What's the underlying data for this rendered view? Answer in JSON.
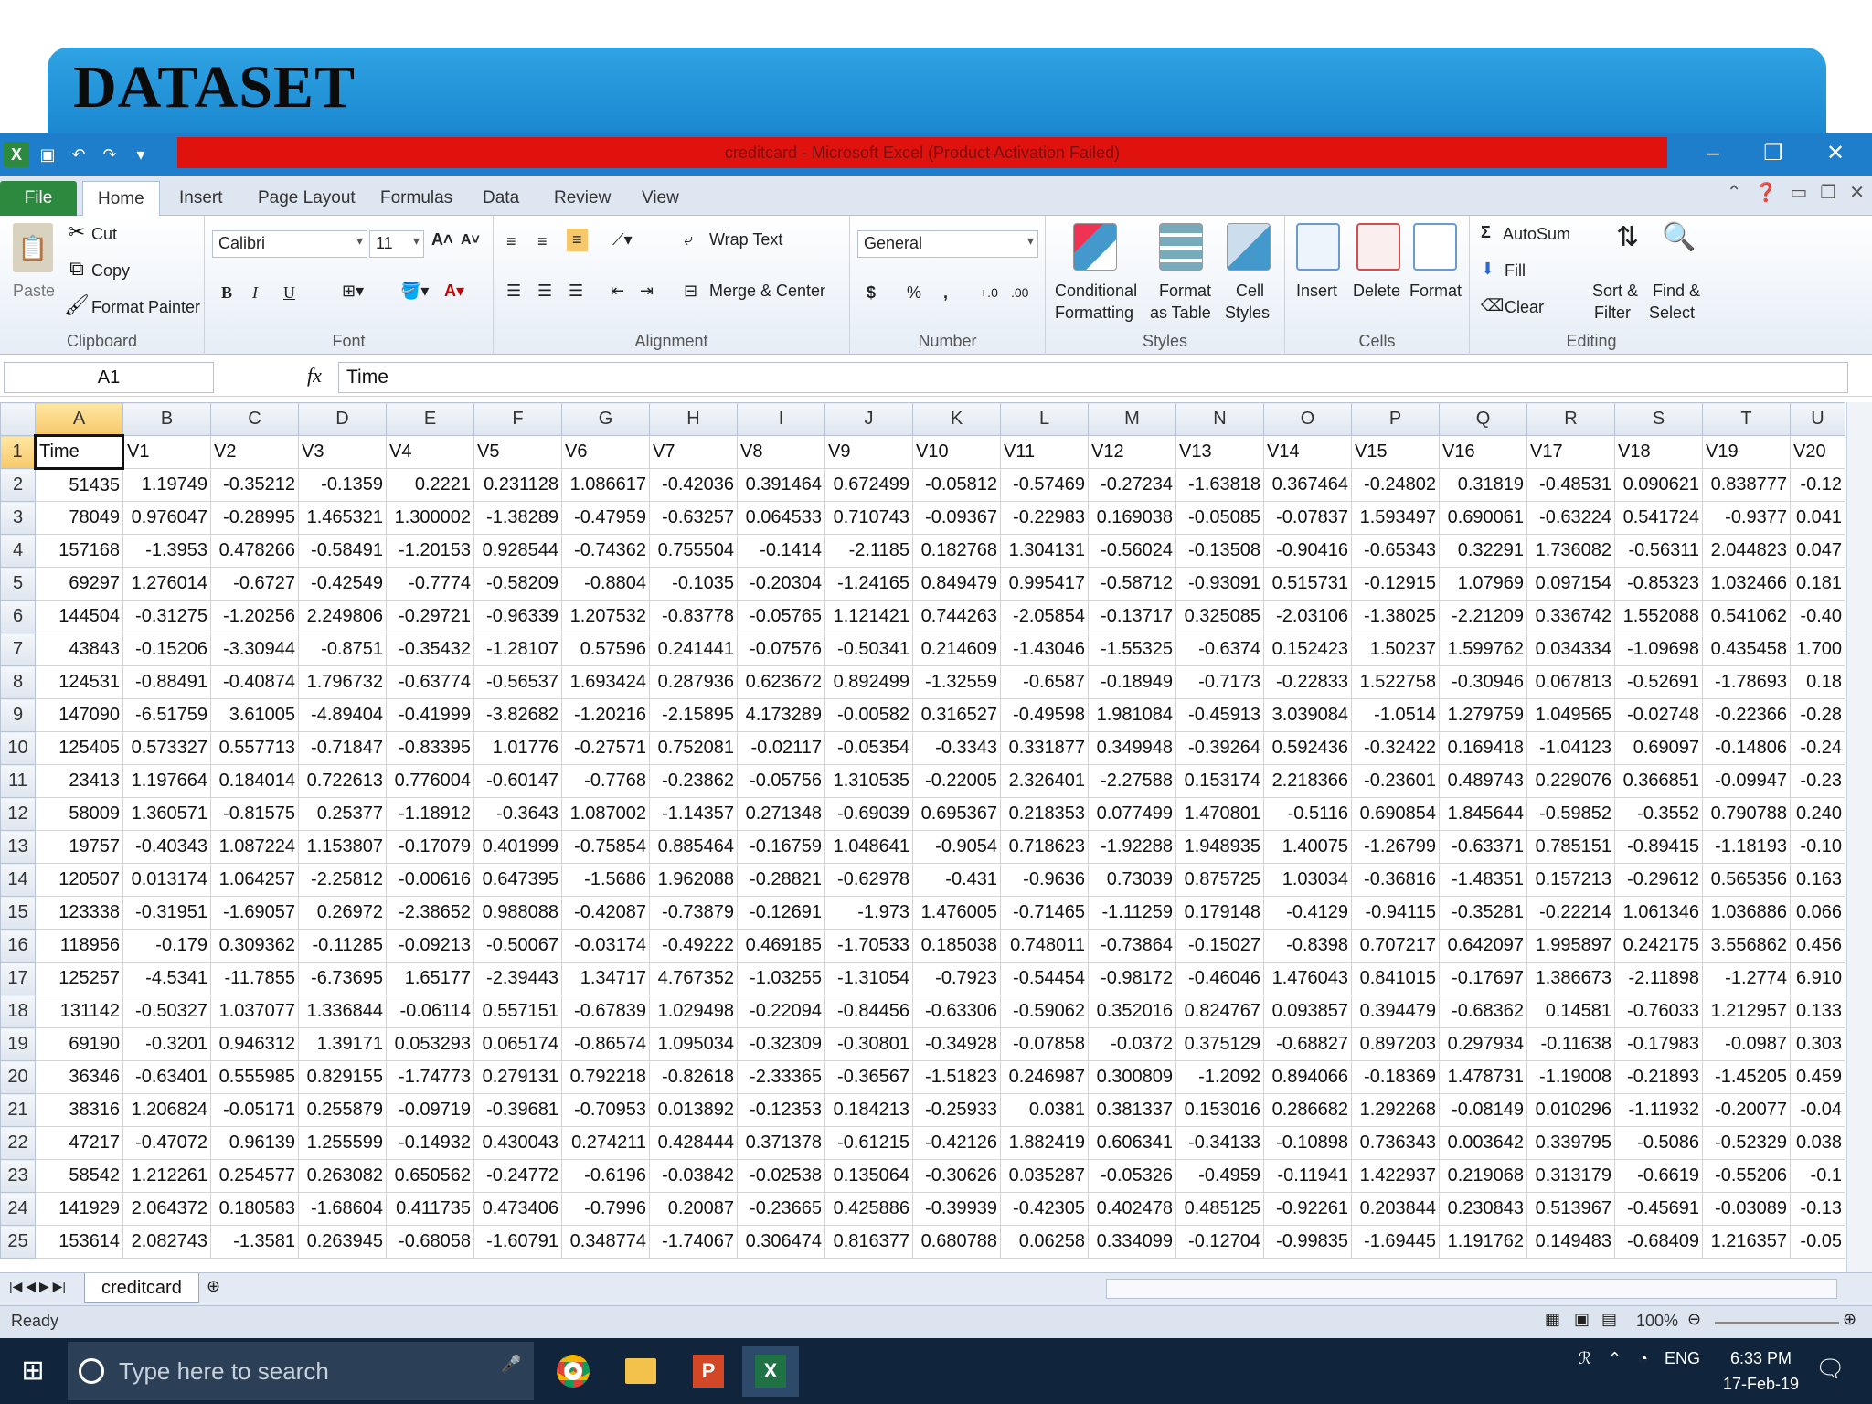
{
  "slide": {
    "title": "DATASET"
  },
  "window": {
    "title": "creditcard - Microsoft Excel (Product Activation Failed)"
  },
  "ribbon": {
    "tabs": [
      "File",
      "Home",
      "Insert",
      "Page Layout",
      "Formulas",
      "Data",
      "Review",
      "View"
    ],
    "active_tab": "Home",
    "clipboard": {
      "paste": "Paste",
      "cut": "Cut",
      "copy": "Copy",
      "format_painter": "Format Painter",
      "label": "Clipboard"
    },
    "font": {
      "name": "Calibri",
      "size": "11",
      "bold": "B",
      "italic": "I",
      "underline": "U",
      "label": "Font"
    },
    "alignment": {
      "wrap": "Wrap Text",
      "merge": "Merge & Center",
      "label": "Alignment"
    },
    "number": {
      "format": "General",
      "currency": "$",
      "percent": "%",
      "comma": ",",
      "label": "Number"
    },
    "styles": {
      "conditional": "Conditional",
      "conditional2": "Formatting",
      "format_table": "Format",
      "format_table2": "as Table",
      "cell_styles": "Cell",
      "cell_styles2": "Styles",
      "label": "Styles"
    },
    "cells": {
      "insert": "Insert",
      "delete": "Delete",
      "format": "Format",
      "label": "Cells"
    },
    "editing": {
      "autosum": "AutoSum",
      "fill": "Fill",
      "clear": "Clear",
      "sort": "Sort &",
      "sort2": "Filter",
      "find": "Find &",
      "find2": "Select",
      "label": "Editing"
    }
  },
  "formula_bar": {
    "cell_ref": "A1",
    "fx": "fx",
    "value": "Time"
  },
  "sheet": {
    "columns": [
      "A",
      "B",
      "C",
      "D",
      "E",
      "F",
      "G",
      "H",
      "I",
      "J",
      "K",
      "L",
      "M",
      "N",
      "O",
      "P",
      "Q",
      "R",
      "S",
      "T",
      "U"
    ],
    "rows": [
      [
        "Time",
        "V1",
        "V2",
        "V3",
        "V4",
        "V5",
        "V6",
        "V7",
        "V8",
        "V9",
        "V10",
        "V11",
        "V12",
        "V13",
        "V14",
        "V15",
        "V16",
        "V17",
        "V18",
        "V19",
        "V20"
      ],
      [
        "51435",
        "1.19749",
        "-0.35212",
        "-0.1359",
        "0.2221",
        "0.231128",
        "1.086617",
        "-0.42036",
        "0.391464",
        "0.672499",
        "-0.05812",
        "-0.57469",
        "-0.27234",
        "-1.63818",
        "0.367464",
        "-0.24802",
        "0.31819",
        "-0.48531",
        "0.090621",
        "0.838777",
        "-0.12"
      ],
      [
        "78049",
        "0.976047",
        "-0.28995",
        "1.465321",
        "1.300002",
        "-1.38289",
        "-0.47959",
        "-0.63257",
        "0.064533",
        "0.710743",
        "-0.09367",
        "-0.22983",
        "0.169038",
        "-0.05085",
        "-0.07837",
        "1.593497",
        "0.690061",
        "-0.63224",
        "0.541724",
        "-0.9377",
        "0.041"
      ],
      [
        "157168",
        "-1.3953",
        "0.478266",
        "-0.58491",
        "-1.20153",
        "0.928544",
        "-0.74362",
        "0.755504",
        "-0.1414",
        "-2.1185",
        "0.182768",
        "1.304131",
        "-0.56024",
        "-0.13508",
        "-0.90416",
        "-0.65343",
        "0.32291",
        "1.736082",
        "-0.56311",
        "2.044823",
        "0.047"
      ],
      [
        "69297",
        "1.276014",
        "-0.6727",
        "-0.42549",
        "-0.7774",
        "-0.58209",
        "-0.8804",
        "-0.1035",
        "-0.20304",
        "-1.24165",
        "0.849479",
        "0.995417",
        "-0.58712",
        "-0.93091",
        "0.515731",
        "-0.12915",
        "1.07969",
        "0.097154",
        "-0.85323",
        "1.032466",
        "0.181"
      ],
      [
        "144504",
        "-0.31275",
        "-1.20256",
        "2.249806",
        "-0.29721",
        "-0.96339",
        "1.207532",
        "-0.83778",
        "-0.05765",
        "1.121421",
        "0.744263",
        "-2.05854",
        "-0.13717",
        "0.325085",
        "-2.03106",
        "-1.38025",
        "-2.21209",
        "0.336742",
        "1.552088",
        "0.541062",
        "-0.40"
      ],
      [
        "43843",
        "-0.15206",
        "-3.30944",
        "-0.8751",
        "-0.35432",
        "-1.28107",
        "0.57596",
        "0.241441",
        "-0.07576",
        "-0.50341",
        "0.214609",
        "-1.43046",
        "-1.55325",
        "-0.6374",
        "0.152423",
        "1.50237",
        "1.599762",
        "0.034334",
        "-1.09698",
        "0.435458",
        "1.700"
      ],
      [
        "124531",
        "-0.88491",
        "-0.40874",
        "1.796732",
        "-0.63774",
        "-0.56537",
        "1.693424",
        "0.287936",
        "0.623672",
        "0.892499",
        "-1.32559",
        "-0.6587",
        "-0.18949",
        "-0.7173",
        "-0.22833",
        "1.522758",
        "-0.30946",
        "0.067813",
        "-0.52691",
        "-1.78693",
        "0.18"
      ],
      [
        "147090",
        "-6.51759",
        "3.61005",
        "-4.89404",
        "-0.41999",
        "-3.82682",
        "-1.20216",
        "-2.15895",
        "4.173289",
        "-0.00582",
        "0.316527",
        "-0.49598",
        "1.981084",
        "-0.45913",
        "3.039084",
        "-1.0514",
        "1.279759",
        "1.049565",
        "-0.02748",
        "-0.22366",
        "-0.28"
      ],
      [
        "125405",
        "0.573327",
        "0.557713",
        "-0.71847",
        "-0.83395",
        "1.01776",
        "-0.27571",
        "0.752081",
        "-0.02117",
        "-0.05354",
        "-0.3343",
        "0.331877",
        "0.349948",
        "-0.39264",
        "0.592436",
        "-0.32422",
        "0.169418",
        "-1.04123",
        "0.69097",
        "-0.14806",
        "-0.24"
      ],
      [
        "23413",
        "1.197664",
        "0.184014",
        "0.722613",
        "0.776004",
        "-0.60147",
        "-0.7768",
        "-0.23862",
        "-0.05756",
        "1.310535",
        "-0.22005",
        "2.326401",
        "-2.27588",
        "0.153174",
        "2.218366",
        "-0.23601",
        "0.489743",
        "0.229076",
        "0.366851",
        "-0.09947",
        "-0.23"
      ],
      [
        "58009",
        "1.360571",
        "-0.81575",
        "0.25377",
        "-1.18912",
        "-0.3643",
        "1.087002",
        "-1.14357",
        "0.271348",
        "-0.69039",
        "0.695367",
        "0.218353",
        "0.077499",
        "1.470801",
        "-0.5116",
        "0.690854",
        "1.845644",
        "-0.59852",
        "-0.3552",
        "0.790788",
        "0.240"
      ],
      [
        "19757",
        "-0.40343",
        "1.087224",
        "1.153807",
        "-0.17079",
        "0.401999",
        "-0.75854",
        "0.885464",
        "-0.16759",
        "1.048641",
        "-0.9054",
        "0.718623",
        "-1.92288",
        "1.948935",
        "1.40075",
        "-1.26799",
        "-0.63371",
        "0.785151",
        "-0.89415",
        "-1.18193",
        "-0.10"
      ],
      [
        "120507",
        "0.013174",
        "1.064257",
        "-2.25812",
        "-0.00616",
        "0.647395",
        "-1.5686",
        "1.962088",
        "-0.28821",
        "-0.62978",
        "-0.431",
        "-0.9636",
        "0.73039",
        "0.875725",
        "1.03034",
        "-0.36816",
        "-1.48351",
        "0.157213",
        "-0.29612",
        "0.565356",
        "0.163"
      ],
      [
        "123338",
        "-0.31951",
        "-1.69057",
        "0.26972",
        "-2.38652",
        "0.988088",
        "-0.42087",
        "-0.73879",
        "-0.12691",
        "-1.973",
        "1.476005",
        "-0.71465",
        "-1.11259",
        "0.179148",
        "-0.4129",
        "-0.94115",
        "-0.35281",
        "-0.22214",
        "1.061346",
        "1.036886",
        "0.066"
      ],
      [
        "118956",
        "-0.179",
        "0.309362",
        "-0.11285",
        "-0.09213",
        "-0.50067",
        "-0.03174",
        "-0.49222",
        "0.469185",
        "-1.70533",
        "0.185038",
        "0.748011",
        "-0.73864",
        "-0.15027",
        "-0.8398",
        "0.707217",
        "0.642097",
        "1.995897",
        "0.242175",
        "3.556862",
        "0.456"
      ],
      [
        "125257",
        "-4.5341",
        "-11.7855",
        "-6.73695",
        "1.65177",
        "-2.39443",
        "1.34717",
        "4.767352",
        "-1.03255",
        "-1.31054",
        "-0.7923",
        "-0.54454",
        "-0.98172",
        "-0.46046",
        "1.476043",
        "0.841015",
        "-0.17697",
        "1.386673",
        "-2.11898",
        "-1.2774",
        "6.910"
      ],
      [
        "131142",
        "-0.50327",
        "1.037077",
        "1.336844",
        "-0.06114",
        "0.557151",
        "-0.67839",
        "1.029498",
        "-0.22094",
        "-0.84456",
        "-0.63306",
        "-0.59062",
        "0.352016",
        "0.824767",
        "0.093857",
        "0.394479",
        "-0.68362",
        "0.14581",
        "-0.76033",
        "1.212957",
        "0.133"
      ],
      [
        "69190",
        "-0.3201",
        "0.946312",
        "1.39171",
        "0.053293",
        "0.065174",
        "-0.86574",
        "1.095034",
        "-0.32309",
        "-0.30801",
        "-0.34928",
        "-0.07858",
        "-0.0372",
        "0.375129",
        "-0.68827",
        "0.897203",
        "0.297934",
        "-0.11638",
        "-0.17983",
        "-0.0987",
        "0.303"
      ],
      [
        "36346",
        "-0.63401",
        "0.555985",
        "0.829155",
        "-1.74773",
        "0.279131",
        "0.792218",
        "-0.82618",
        "-2.33365",
        "-0.36567",
        "-1.51823",
        "0.246987",
        "0.300809",
        "-1.2092",
        "0.894066",
        "-0.18369",
        "1.478731",
        "-1.19008",
        "-0.21893",
        "-1.45205",
        "0.459"
      ],
      [
        "38316",
        "1.206824",
        "-0.05171",
        "0.255879",
        "-0.09719",
        "-0.39681",
        "-0.70953",
        "0.013892",
        "-0.12353",
        "0.184213",
        "-0.25933",
        "0.0381",
        "0.381337",
        "0.153016",
        "0.286682",
        "1.292268",
        "-0.08149",
        "0.010296",
        "-1.11932",
        "-0.20077",
        "-0.04"
      ],
      [
        "47217",
        "-0.47072",
        "0.96139",
        "1.255599",
        "-0.14932",
        "0.430043",
        "0.274211",
        "0.428444",
        "0.371378",
        "-0.61215",
        "-0.42126",
        "1.882419",
        "0.606341",
        "-0.34133",
        "-0.10898",
        "0.736343",
        "0.003642",
        "0.339795",
        "-0.5086",
        "-0.52329",
        "0.038"
      ],
      [
        "58542",
        "1.212261",
        "0.254577",
        "0.263082",
        "0.650562",
        "-0.24772",
        "-0.6196",
        "-0.03842",
        "-0.02538",
        "0.135064",
        "-0.30626",
        "0.035287",
        "-0.05326",
        "-0.4959",
        "-0.11941",
        "1.422937",
        "0.219068",
        "0.313179",
        "-0.6619",
        "-0.55206",
        "-0.1"
      ],
      [
        "141929",
        "2.064372",
        "0.180583",
        "-1.68604",
        "0.411735",
        "0.473406",
        "-0.7996",
        "0.20087",
        "-0.23665",
        "0.425886",
        "-0.39939",
        "-0.42305",
        "0.402478",
        "0.485125",
        "-0.92261",
        "0.203844",
        "0.230843",
        "0.513967",
        "-0.45691",
        "-0.03089",
        "-0.13"
      ],
      [
        "153614",
        "2.082743",
        "-1.3581",
        "0.263945",
        "-0.68058",
        "-1.60791",
        "0.348774",
        "-1.74067",
        "0.306474",
        "0.816377",
        "0.680788",
        "0.06258",
        "0.334099",
        "-0.12704",
        "-0.99835",
        "-1.69445",
        "1.191762",
        "0.149483",
        "-0.68409",
        "1.216357",
        "-0.05"
      ]
    ],
    "sheet_tab": "creditcard"
  },
  "status": {
    "ready": "Ready",
    "zoom": "100%"
  },
  "taskbar": {
    "search_placeholder": "Type here to search",
    "lang": "ENG",
    "time": "6:33 PM",
    "date": "17-Feb-19"
  },
  "colors": {
    "accent": "#1f7ecb",
    "file_tab": "#2b8a3e",
    "activation_bar": "#e0120d",
    "taskbar": "#10243c"
  }
}
